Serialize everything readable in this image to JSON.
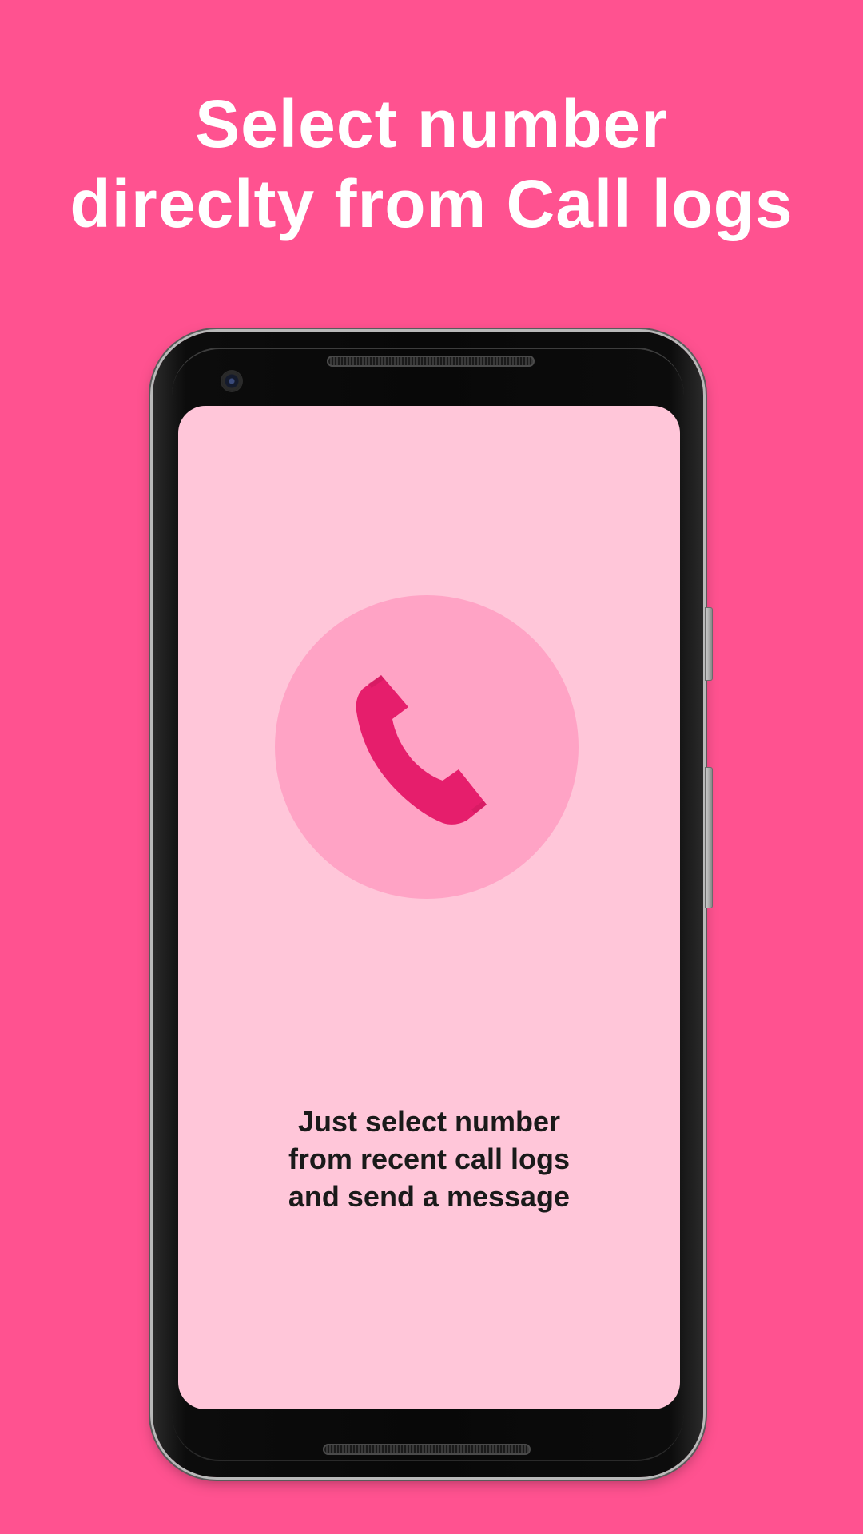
{
  "headline": {
    "line1": "Select number",
    "line2": "direclty from Call logs"
  },
  "screen": {
    "icon": "phone-handset-icon",
    "message_lines": [
      "Just select number",
      " from recent call logs",
      " and send a message"
    ]
  },
  "colors": {
    "background": "#ff5290",
    "screen_background": "#ffc6d9",
    "icon_circle": "#ffa3c5",
    "icon": "#e61e6c",
    "headline_text": "#ffffff",
    "body_text": "#1a1a1a"
  }
}
